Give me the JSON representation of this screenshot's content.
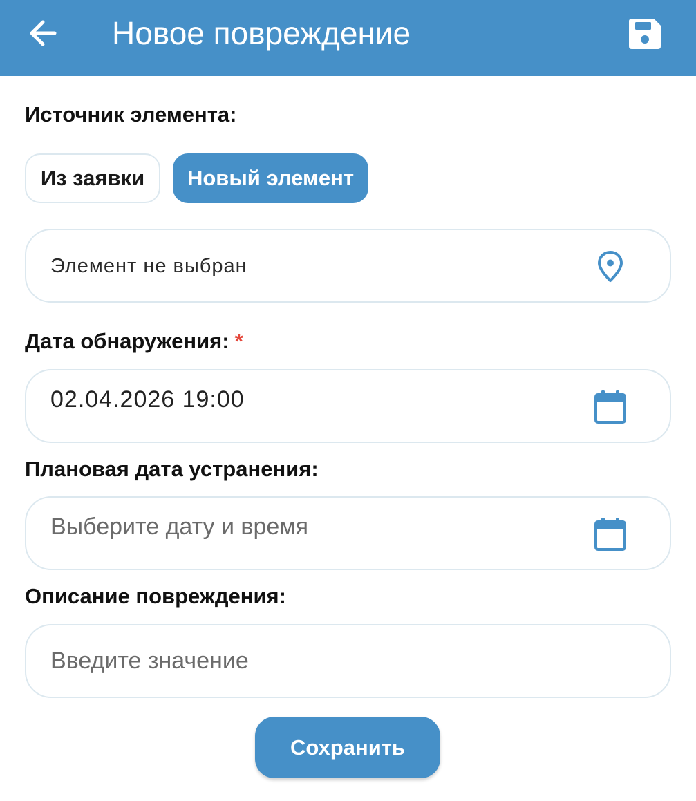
{
  "header": {
    "title": "Новое повреждение",
    "back_icon": "arrow-left-icon",
    "save_icon": "floppy-disk-icon"
  },
  "source": {
    "label": "Источник элемента:",
    "options": [
      "Из заявки",
      "Новый элемент"
    ],
    "selected": "Новый элемент"
  },
  "element": {
    "value": "Элемент не выбран",
    "icon": "map-pin-icon"
  },
  "detect_date": {
    "label": "Дата обнаружения:",
    "required_mark": "*",
    "value": "02.04.2026 19:00",
    "icon": "calendar-icon"
  },
  "planned_date": {
    "label": "Плановая дата устранения:",
    "placeholder": "Выберите дату и время",
    "icon": "calendar-icon"
  },
  "description": {
    "label": "Описание повреждения:",
    "placeholder": "Введите значение"
  },
  "save_button": {
    "label": "Сохранить"
  },
  "colors": {
    "accent": "#4690c8",
    "border": "#dce8ef",
    "required": "#e5483c"
  }
}
